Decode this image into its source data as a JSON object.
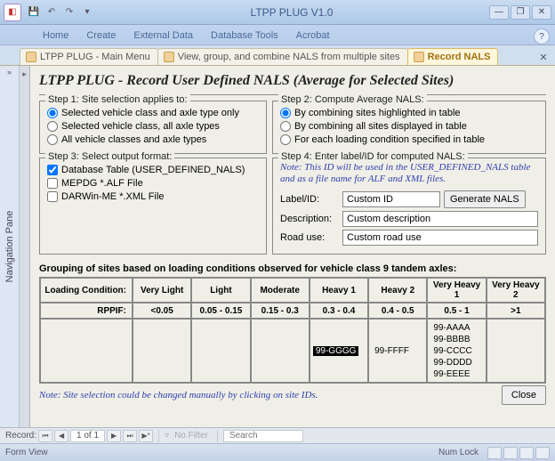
{
  "window": {
    "title": "LTPP PLUG V1.0"
  },
  "ribbon": {
    "tabs": [
      "Home",
      "Create",
      "External Data",
      "Database Tools",
      "Acrobat"
    ]
  },
  "docTabs": {
    "t0": "LTPP PLUG - Main Menu",
    "t1": "View, group, and combine NALS from multiple sites",
    "t2": "Record NALS"
  },
  "navPane": "Navigation Pane",
  "form": {
    "title": "LTPP PLUG - Record User Defined NALS (Average for Selected Sites)"
  },
  "step1": {
    "legend": "Step 1: Site selection applies to:",
    "o1": "Selected vehicle class and axle type only",
    "o2": "Selected vehicle class, all axle types",
    "o3": "All vehicle classes and axle types"
  },
  "step2": {
    "legend": "Step 2: Compute Average NALS:",
    "o1": "By combining sites highlighted in table",
    "o2": "By combining all sites displayed in table",
    "o3": "For each loading condition specified in table"
  },
  "step3": {
    "legend": "Step 3: Select output format:",
    "o1": "Database Table (USER_DEFINED_NALS)",
    "o2": "MEPDG *.ALF File",
    "o3": "DARWin-ME *.XML File"
  },
  "step4": {
    "legend": "Step 4: Enter label/ID for computed NALS:",
    "note": "Note: This ID will be used in the USER_DEFINED_NALS table and as a file name for ALF and XML files.",
    "labelId_label": "Label/ID:",
    "labelId_value": "Custom ID",
    "desc_label": "Description:",
    "desc_value": "Custom description",
    "road_label": "Road use:",
    "road_value": "Custom road use",
    "generate": "Generate NALS"
  },
  "grouping": {
    "caption": "Grouping of sites based on loading conditions observed for vehicle class 9 tandem axles:",
    "head0": "Loading Condition:",
    "head1": "Very Light",
    "head2": "Light",
    "head3": "Moderate",
    "head4": "Heavy 1",
    "head5": "Heavy 2",
    "head6": "Very Heavy 1",
    "head7": "Very Heavy 2",
    "rppif": "RPPIF:",
    "r1": "<0.05",
    "r2": "0.05 - 0.15",
    "r3": "0.15 - 0.3",
    "r4": "0.3 - 0.4",
    "r5": "0.4 - 0.5",
    "r6": "0.5 - 1",
    "r7": ">1",
    "c4a": "99-GGGG",
    "c5a": "99-FFFF",
    "c6a": "99-AAAA",
    "c6b": "99-BBBB",
    "c6c": "99-CCCC",
    "c6d": "99-DDDD",
    "c6e": "99-EEEE"
  },
  "footerNote": "Note: Site selection could be changed manually by clicking on site IDs.",
  "close": "Close",
  "recordNav": {
    "label": "Record:",
    "pos": "1 of 1",
    "noFilter": "No Filter",
    "search": "Search"
  },
  "status": {
    "left": "Form View",
    "numlock": "Num Lock"
  }
}
